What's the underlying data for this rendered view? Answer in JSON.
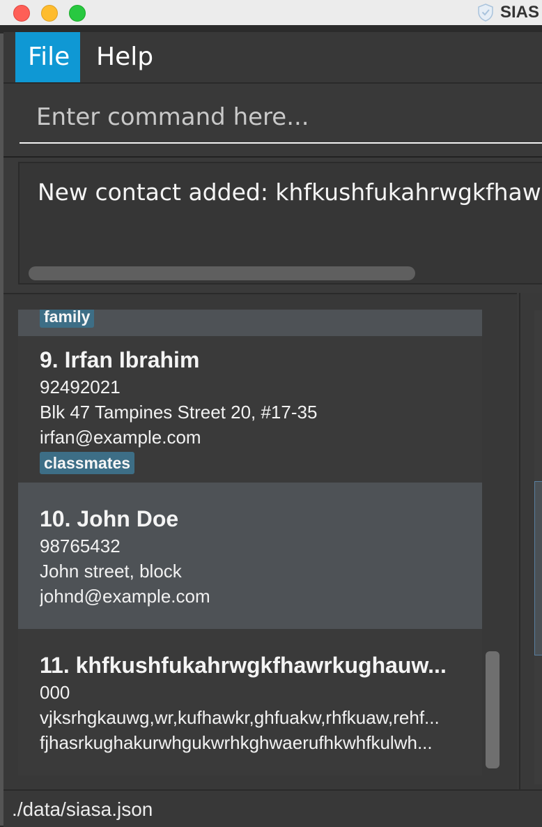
{
  "window": {
    "title": "SIAS"
  },
  "menu": {
    "file": "File",
    "help": "Help"
  },
  "command": {
    "placeholder": "Enter command here..."
  },
  "result": {
    "text": "New contact added: khfkushfukahrwgkfhawrkughauw"
  },
  "contacts": [
    {
      "tag": "family"
    },
    {
      "index": "9.",
      "name": "Irfan Ibrahim",
      "phone": "92492021",
      "address": "Blk 47 Tampines Street 20, #17-35",
      "email": "irfan@example.com",
      "tag": "classmates"
    },
    {
      "index": "10.",
      "name": "John Doe",
      "phone": "98765432",
      "address": "John street, block",
      "email": "johnd@example.com"
    },
    {
      "index": "11.",
      "name": "khfkushfukahrwgkfhawrkughauw...",
      "phone": "000",
      "address": "vjksrhgkauwg,wr,kufhawkr,ghfuakw,rhfkuaw,rehf...",
      "email": "fjhasrkughakurwhgukwrhkghwaerufhkwhfkulwh..."
    }
  ],
  "status": {
    "path": "./data/siasa.json"
  },
  "colors": {
    "accent": "#0f98d4",
    "tag": "#3d6e86",
    "background": "#383838",
    "selected_card": "#4e5256"
  }
}
